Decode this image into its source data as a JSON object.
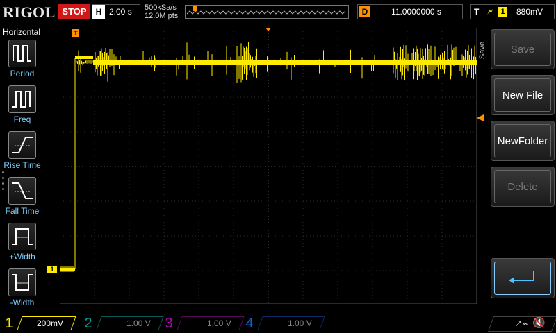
{
  "header": {
    "logo": "RIGOL",
    "run_state": "STOP",
    "horizontal_label": "H",
    "timebase": "2.00 s",
    "sample_rate": "500kSa/s",
    "memory_depth": "12.0M pts",
    "delay_label": "D",
    "delay_value": "11.0000000 s",
    "trigger_label": "T",
    "trigger_source": "1",
    "trigger_level": "880mV"
  },
  "left_menu": {
    "title": "Horizontal",
    "items": [
      {
        "label": "Period",
        "icon": "period-icon"
      },
      {
        "label": "Freq",
        "icon": "freq-icon"
      },
      {
        "label": "Rise Time",
        "icon": "rise-time-icon"
      },
      {
        "label": "Fall Time",
        "icon": "fall-time-icon"
      },
      {
        "label": "+Width",
        "icon": "positive-width-icon"
      },
      {
        "label": "-Width",
        "icon": "negative-width-icon"
      }
    ]
  },
  "right_menu": {
    "title": "Save",
    "buttons": [
      {
        "label": "Save",
        "enabled": false
      },
      {
        "label": "New File",
        "enabled": true
      },
      {
        "label": "NewFolder",
        "enabled": true
      },
      {
        "label": "Delete",
        "enabled": false
      }
    ],
    "enter_icon": "enter-icon"
  },
  "channels": [
    {
      "num": "1",
      "scale": "200mV",
      "color": "#ffeb00",
      "active": true
    },
    {
      "num": "2",
      "scale": "1.00 V",
      "color": "#00a0a0",
      "active": false
    },
    {
      "num": "3",
      "scale": "1.00 V",
      "color": "#c000c0",
      "active": false
    },
    {
      "num": "4",
      "scale": "1.00 V",
      "color": "#1060d0",
      "active": false
    }
  ],
  "trace": {
    "color": "#ffeb00",
    "marker": "1"
  },
  "markers": {
    "trigger_position": "T"
  },
  "status_icons": {
    "usb": "usb-icon",
    "speaker": "speaker-muted-icon"
  }
}
